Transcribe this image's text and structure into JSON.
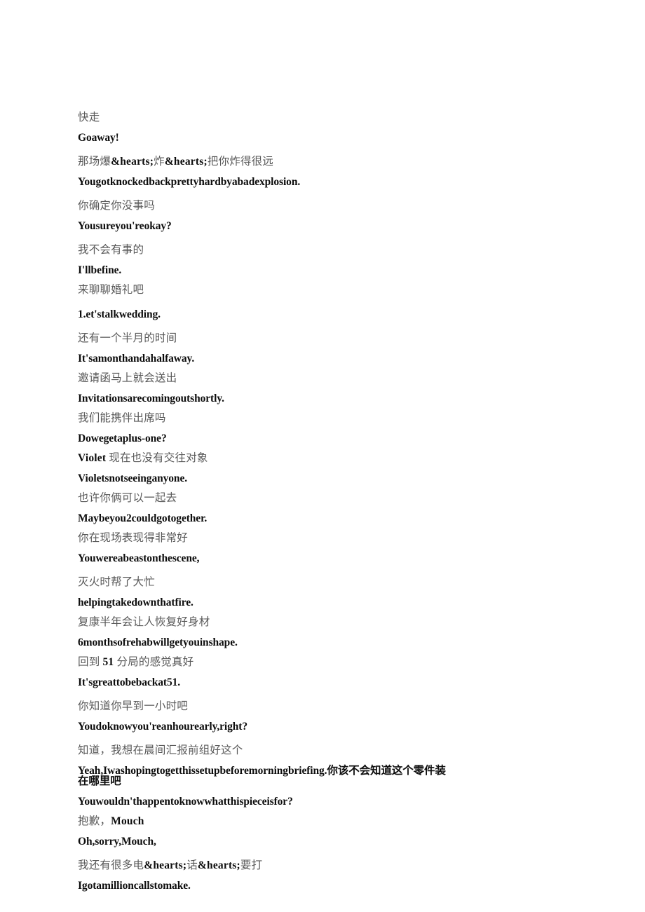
{
  "document": {
    "type": "bilingual-subtitle-transcript",
    "page_background": "#ffffff",
    "source_text_color": "#595959",
    "translation_text_color": "#0d0d0d",
    "lines": [
      {
        "lang": "zh",
        "text": "快走",
        "gap": "none"
      },
      {
        "lang": "en",
        "text": "Goaway!",
        "gap": "sm"
      },
      {
        "lang": "zh",
        "text": "那场爆&hearts;炸&hearts;把你炸得很远",
        "gap": "md"
      },
      {
        "lang": "en",
        "text": "Yougotknockedbackprettyhardbyabadexplosion.",
        "gap": "sm"
      },
      {
        "lang": "zh",
        "text": "你确定你没事吗",
        "gap": "md"
      },
      {
        "lang": "en",
        "text": "Yousureyou'reokay?",
        "gap": "sm"
      },
      {
        "lang": "zh",
        "text": "我不会有事的",
        "gap": "md"
      },
      {
        "lang": "en",
        "text": "I'llbefine.",
        "gap": "sm"
      },
      {
        "lang": "zh",
        "text": "来聊聊婚礼吧",
        "gap": "sm"
      },
      {
        "lang": "en",
        "text": "1.et'stalkwedding.",
        "gap": "md"
      },
      {
        "lang": "zh",
        "text": "还有一个半月的时间",
        "gap": "md"
      },
      {
        "lang": "en",
        "text": "It'samonthandahalfaway.",
        "gap": "sm"
      },
      {
        "lang": "zh",
        "text": "邀请函马上就会送出",
        "gap": "sm"
      },
      {
        "lang": "en",
        "text": "Invitationsarecomingoutshortly.",
        "gap": "sm"
      },
      {
        "lang": "zh",
        "text": "我们能携伴出席吗",
        "gap": "sm"
      },
      {
        "lang": "en",
        "text": "Dowegetaplus-one?",
        "gap": "sm"
      },
      {
        "lang": "zh",
        "text": "Violet 现在也没有交往对象",
        "gap": "sm"
      },
      {
        "lang": "en",
        "text": "Violetsnotseeinganyone.",
        "gap": "sm"
      },
      {
        "lang": "zh",
        "text": "也许你俩可以一起去",
        "gap": "sm"
      },
      {
        "lang": "en",
        "text": "Maybeyou2couldgotogether.",
        "gap": "sm"
      },
      {
        "lang": "zh",
        "text": "你在现场表现得非常好",
        "gap": "sm"
      },
      {
        "lang": "en",
        "text": "Youwereabeastonthescene,",
        "gap": "sm"
      },
      {
        "lang": "zh",
        "text": "灭火时帮了大忙",
        "gap": "md"
      },
      {
        "lang": "en",
        "text": "helpingtakedownthatfire.",
        "gap": "sm"
      },
      {
        "lang": "zh",
        "text": "复康半年会让人恢复好身材",
        "gap": "sm"
      },
      {
        "lang": "en",
        "text": "6monthsofrehabwillgetyouinshape.",
        "gap": "sm"
      },
      {
        "lang": "zh",
        "text": "回到 51 分局的感觉真好",
        "gap": "sm"
      },
      {
        "lang": "en",
        "text": "It'sgreattobebackat51.",
        "gap": "sm"
      },
      {
        "lang": "zh",
        "text": "你知道你早到一小时吧",
        "gap": "md"
      },
      {
        "lang": "en",
        "text": "Youdoknowyou'reanhourearly,right?",
        "gap": "sm"
      },
      {
        "lang": "zh",
        "text": "知道，我想在晨间汇报前组好这个",
        "gap": "md"
      },
      {
        "lang": "en",
        "text": "Yeah,Iwashopingtogetthissetupbeforemorningbriefing.你该不会知道这个零件装在哪里吧",
        "gap": "sm",
        "wrap": true
      },
      {
        "lang": "en",
        "text": "Youwouldn'thappentoknowwhatthispieceisfor?",
        "gap": "sm"
      },
      {
        "lang": "zh",
        "text": "抱歉，Mouch",
        "gap": "sm"
      },
      {
        "lang": "en",
        "text": "Oh,sorry,Mouch,",
        "gap": "sm"
      },
      {
        "lang": "zh",
        "text": "我还有很多电&hearts;话&hearts;要打",
        "gap": "md"
      },
      {
        "lang": "en",
        "text": "Igotamillioncallstomake.",
        "gap": "sm"
      }
    ]
  }
}
